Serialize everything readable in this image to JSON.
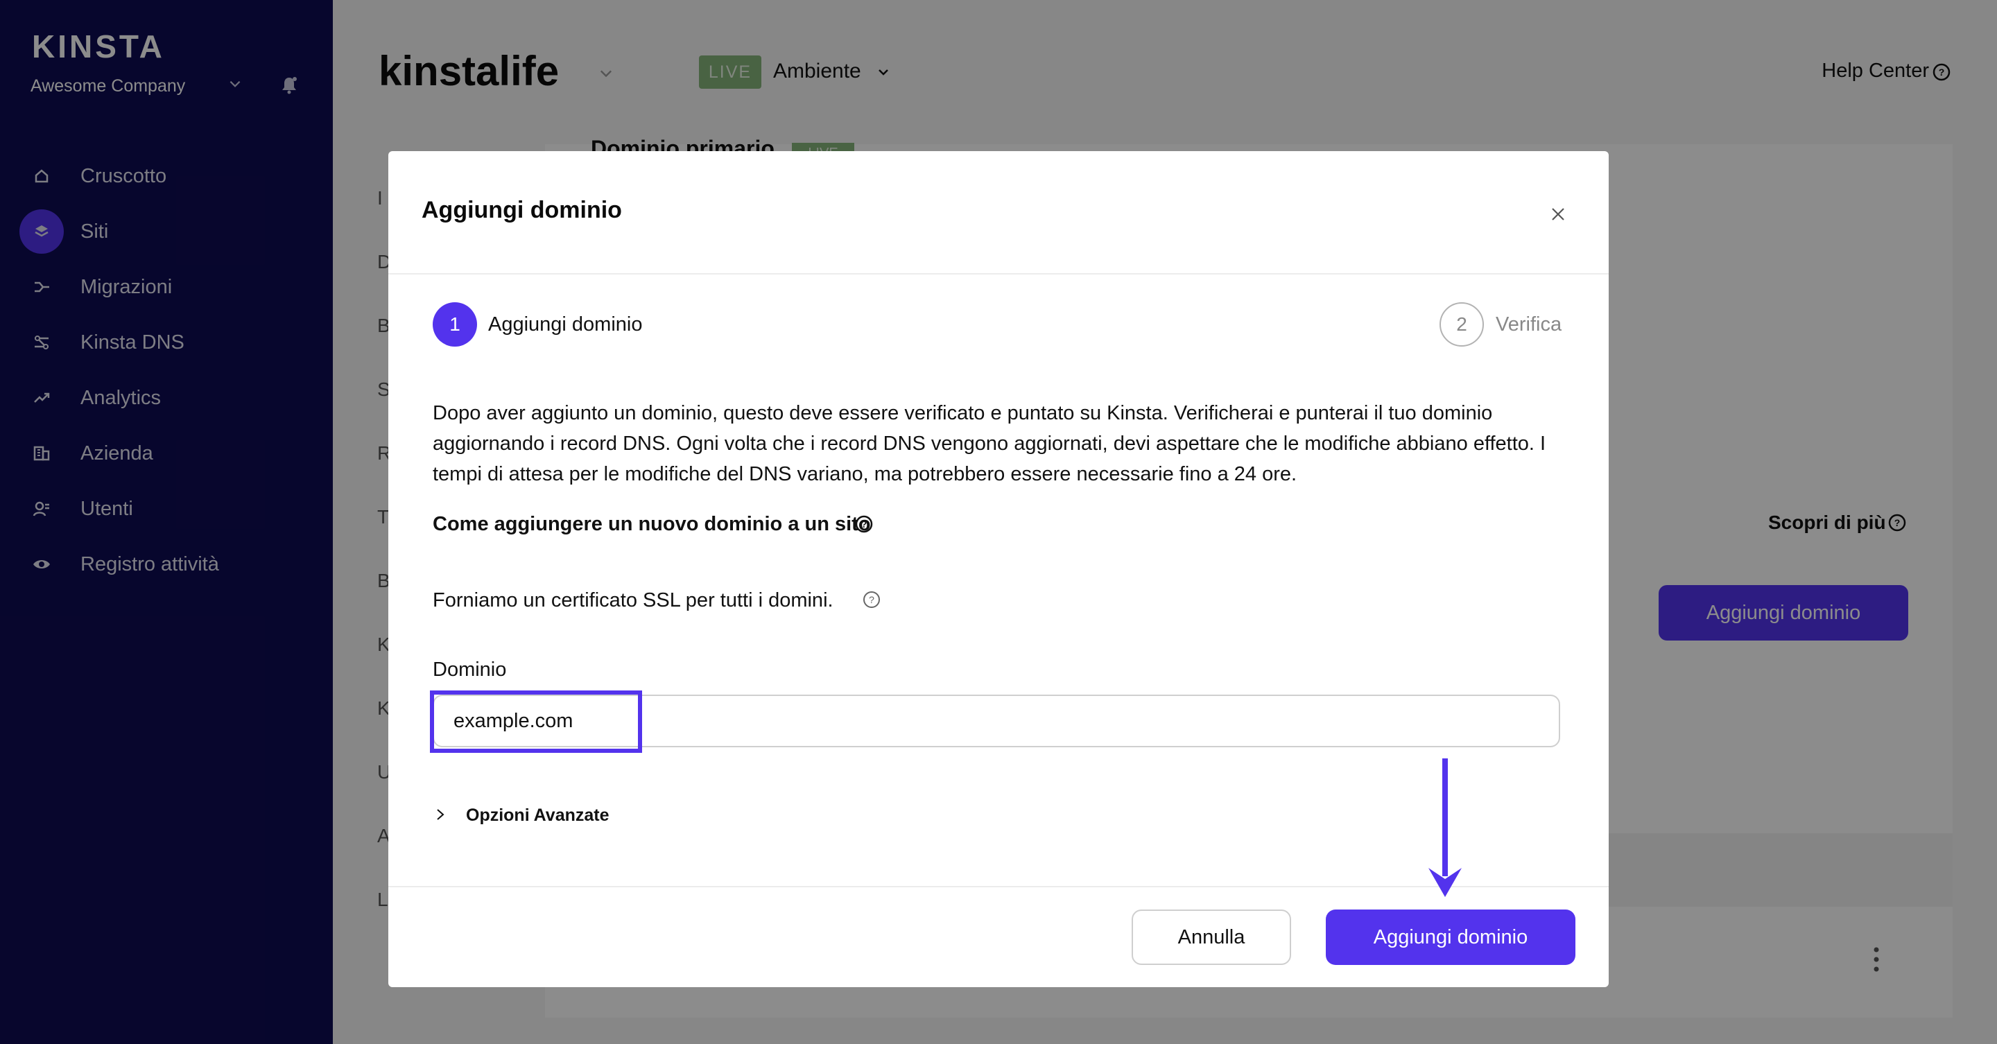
{
  "sidebar": {
    "logo": "KINSTA",
    "company": "Awesome Company",
    "items": [
      {
        "label": "Cruscotto",
        "icon": "home-icon"
      },
      {
        "label": "Siti",
        "icon": "layers-icon"
      },
      {
        "label": "Migrazioni",
        "icon": "migration-icon"
      },
      {
        "label": "Kinsta DNS",
        "icon": "dns-icon"
      },
      {
        "label": "Analytics",
        "icon": "trend-icon"
      },
      {
        "label": "Azienda",
        "icon": "building-icon"
      },
      {
        "label": "Utenti",
        "icon": "user-icon"
      },
      {
        "label": "Registro attività",
        "icon": "eye-icon"
      }
    ],
    "active_index": 1
  },
  "header": {
    "site_title": "kinstalife",
    "live_badge": "LIVE",
    "environment": "Ambiente",
    "help_center": "Help Center"
  },
  "background": {
    "primary_domain_title": "Dominio primario",
    "primary_live": "LIVE",
    "subnav_letters": [
      "I",
      "D",
      "B",
      "S",
      "R",
      "T",
      "B",
      "K",
      "K",
      "U",
      "A",
      "L"
    ],
    "scopri": "Scopri di più",
    "add_domain_button": "Aggiungi dominio"
  },
  "modal": {
    "title": "Aggiungi dominio",
    "steps": [
      {
        "number": "1",
        "label": "Aggiungi dominio",
        "active": true
      },
      {
        "number": "2",
        "label": "Verifica",
        "active": false
      }
    ],
    "description": "Dopo aver aggiunto un dominio, questo deve essere verificato e puntato su Kinsta. Verificherai e punterai il tuo dominio aggiornando i record DNS. Ogni volta che i record DNS vengono aggiornati, devi aspettare che le modifiche abbiano effetto. I tempi di attesa per le modifiche del DNS variano, ma potrebbero essere necessarie fino a 24 ore.",
    "howto_link": "Come aggiungere un nuovo dominio a un sito",
    "ssl_text": "Forniamo un certificato SSL per tutti i domini.",
    "domain_label": "Dominio",
    "domain_value": "example.com",
    "advanced_options": "Opzioni Avanzate",
    "cancel": "Annulla",
    "submit": "Aggiungi dominio"
  },
  "colors": {
    "sidebar_bg": "#0e0b52",
    "accent": "#5333ed",
    "live_green": "#86b57a"
  }
}
